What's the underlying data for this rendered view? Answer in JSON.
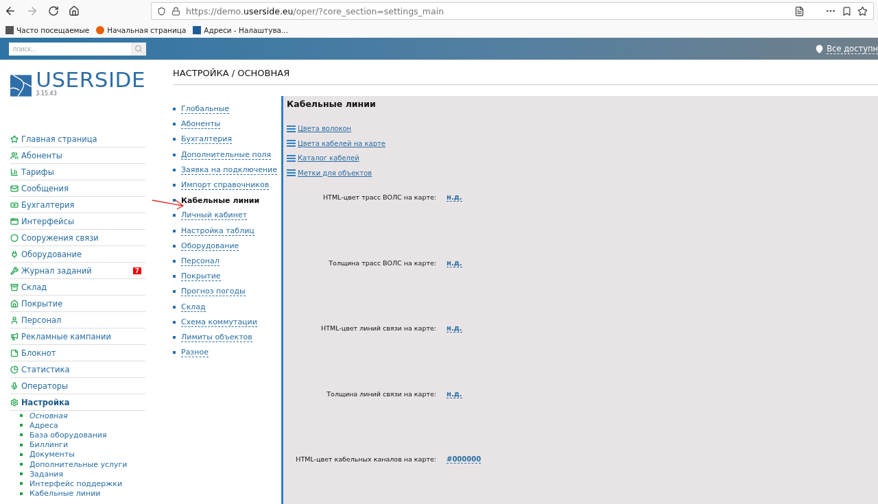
{
  "browser": {
    "url_scheme": "https://demo.",
    "url_host": "userside.eu",
    "url_path": "/oper/?core_section=settings_main",
    "bookmarks": [
      {
        "label": "Часто посещаемые"
      },
      {
        "label": "Начальная страница"
      },
      {
        "label": "Адреси - Налаштува..."
      }
    ]
  },
  "topbar": {
    "search": {
      "placeholder": "поиск..."
    },
    "location": "Все доступн"
  },
  "logo": {
    "name": "USERSIDE",
    "version": "3.15.43"
  },
  "nav": [
    {
      "label": "Главная страница",
      "expanded": false
    },
    {
      "label": "Абоненты",
      "expanded": false
    },
    {
      "label": "Тарифы",
      "expanded": false
    },
    {
      "label": "Сообщения",
      "expanded": false
    },
    {
      "label": "Бухгалтерия",
      "expanded": false
    },
    {
      "label": "Интерфейсы",
      "expanded": false
    },
    {
      "label": "Сооружения связи",
      "expanded": false
    },
    {
      "label": "Оборудование",
      "expanded": false
    },
    {
      "label": "Журнал заданий",
      "badge": "7",
      "expanded": false
    },
    {
      "label": "Склад",
      "expanded": false
    },
    {
      "label": "Покрытие",
      "expanded": false
    },
    {
      "label": "Персонал",
      "expanded": false
    },
    {
      "label": "Рекламные кампании",
      "expanded": false
    },
    {
      "label": "Блокнот",
      "expanded": false
    },
    {
      "label": "Статистика",
      "expanded": false
    },
    {
      "label": "Операторы",
      "expanded": false
    },
    {
      "label": "Настройка",
      "expanded": true,
      "children": [
        {
          "label": "Основная",
          "selected": true
        },
        {
          "label": "Адреса",
          "selected": false
        },
        {
          "label": "База оборудования",
          "selected": false
        },
        {
          "label": "Биллинги",
          "selected": false
        },
        {
          "label": "Документы",
          "selected": false
        },
        {
          "label": "Дополнительные услуги",
          "selected": false
        },
        {
          "label": "Задания",
          "selected": false
        },
        {
          "label": "Интерфейс поддержки",
          "selected": false
        },
        {
          "label": "Кабельные линии",
          "selected": false
        }
      ]
    }
  ],
  "page_title": "НАСТРОЙКА / ОСНОВНАЯ",
  "settings_menu": [
    {
      "label": "Глобальные",
      "selected": false
    },
    {
      "label": "Абоненты",
      "selected": false
    },
    {
      "label": "Бухгалтерия",
      "selected": false
    },
    {
      "label": "Дополнительные поля",
      "selected": false
    },
    {
      "label": "Заявка на подключение",
      "selected": false
    },
    {
      "label": "Импорт справочников",
      "selected": false
    },
    {
      "label": "Кабельные линии",
      "selected": true
    },
    {
      "label": "Личный кабинет",
      "selected": false
    },
    {
      "label": "Настройка таблиц",
      "selected": false
    },
    {
      "label": "Оборудование",
      "selected": false
    },
    {
      "label": "Персонал",
      "selected": false
    },
    {
      "label": "Покрытие",
      "selected": false
    },
    {
      "label": "Прогноз погоды",
      "selected": false
    },
    {
      "label": "Склад",
      "selected": false
    },
    {
      "label": "Схема коммутации",
      "selected": false
    },
    {
      "label": "Лимиты объектов",
      "selected": false
    },
    {
      "label": "Разное",
      "selected": false
    }
  ],
  "panel": {
    "title": "Кабельные линии",
    "links": [
      "Цвета волокон",
      "Цвета кабелей на карте",
      "Каталог кабелей",
      "Метки для объектов"
    ],
    "fields": [
      {
        "label": "HTML-цвет трасс ВОЛС на карте:",
        "value": "н.д."
      },
      {
        "label": "Толщина трасс ВОЛС на карте:",
        "value": "н.д."
      },
      {
        "label": "HTML-цвет линий связи на карте:",
        "value": "н.д."
      },
      {
        "label": "Толщина линий связи на карте:",
        "value": "н.д."
      },
      {
        "label": "HTML-цвет кабельных каналов на карте:",
        "value": "#000000"
      }
    ]
  }
}
